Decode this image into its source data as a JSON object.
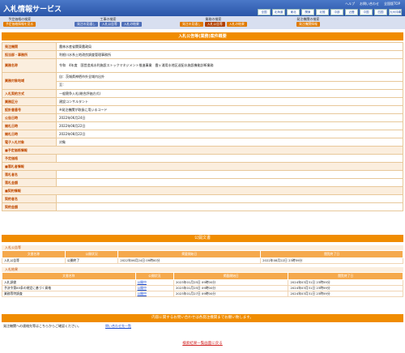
{
  "header": {
    "title": "入札情報サービス",
    "links": [
      "ヘルプ",
      "お問い合わせ",
      "全国版TOP"
    ],
    "regions": [
      "全国",
      "北海道",
      "東北",
      "関東",
      "北陸",
      "中部",
      "近畿",
      "中国",
      "四国",
      "九州沖縄"
    ]
  },
  "nav": {
    "g1": {
      "title": "予定価格の検索",
      "btns": [
        "予定価格情報を見る"
      ]
    },
    "g2": {
      "title": "工事の検索",
      "btns": [
        "発注の見通し",
        "入札公告等",
        "入札の結果"
      ]
    },
    "g3": {
      "title": "業務の検索",
      "btns": [
        "発注の見通し",
        "入札公告等",
        "入札の結果"
      ]
    },
    "g4": {
      "title": "発注機関の検索",
      "btns": [
        "発注機関情報"
      ]
    }
  },
  "detail": {
    "heading": "入札公告等(業務)案件概要",
    "rows": [
      {
        "k": "発注機関",
        "v": "農林水産省関東農政局"
      },
      {
        "k": "担当部・事務所",
        "v": "利根川水系土地改良調査管理事務所"
      },
      {
        "k": "業務名称",
        "v": "令和　4年度　国営造成水利施設ストックマネジメント推進事業　霞ヶ浦用水地区送配水施設機能診断業務"
      },
      {
        "k": "業務対象地域",
        "v": "自：茨城県神栖市外全域内出外"
      },
      {
        "k": "",
        "v": "至："
      },
      {
        "k": "入札契約方式",
        "v": "一般競争入札(総合評価方式)"
      },
      {
        "k": "業務区分",
        "v": "建設コンサルタント"
      },
      {
        "k": "設計書番号",
        "v": "※発注機関が取扱に用いるコード"
      },
      {
        "k": "公告日時",
        "v": "2022年06月24日"
      },
      {
        "k": "開札日時",
        "v": "2022年08月22日"
      },
      {
        "k": "開札日時",
        "v": "2022年08月22日"
      },
      {
        "k": "電子入札対象",
        "v": "対象"
      }
    ],
    "sections": [
      "■予定価格情報",
      "■落札者情報",
      "■契約情報"
    ],
    "sec1": [
      {
        "k": "予定価格",
        "v": ""
      }
    ],
    "sec2": [
      {
        "k": "落札者名",
        "v": ""
      },
      {
        "k": "落札金額",
        "v": ""
      }
    ],
    "sec3": [
      {
        "k": "契約者名",
        "v": ""
      },
      {
        "k": "契約金額",
        "v": ""
      }
    ]
  },
  "docs": {
    "heading": "公開文書",
    "g1": {
      "title": "入札公告等",
      "cols": [
        "文書名称",
        "公開状況",
        "掲載開始日",
        "閲覧終了日"
      ],
      "rows": [
        [
          "入札公告等",
          "公開終了",
          "2022年06月24日 09時00分",
          "2022年08月22日 23時59分"
        ]
      ]
    },
    "g2": {
      "title": "入札結果",
      "cols": [
        "文書名称",
        "公開状況",
        "掲載開始日",
        "閲覧終了日"
      ],
      "rows": [
        [
          "入札調書",
          "公開中",
          "2023年01月25日 09時00分",
          "2024年03月31日 23時59分"
        ],
        [
          "予決令第85条の規定に基づく資格",
          "公開中",
          "2023年01月25日 09時00分",
          "2024年03月31日 23時59分"
        ],
        [
          "業務等特調査",
          "公開中",
          "2023年01月27日 09時00分",
          "2024年03月31日 23時59分"
        ]
      ]
    }
  },
  "inquiry": {
    "heading": "内容に関するお問い合わせは各発注機関までお願い致します。",
    "label": "発注機関への連絡先等はこちらからご確認ください。",
    "link": "問い合わせ先一覧"
  },
  "back": "検索結果一覧画面に戻る"
}
